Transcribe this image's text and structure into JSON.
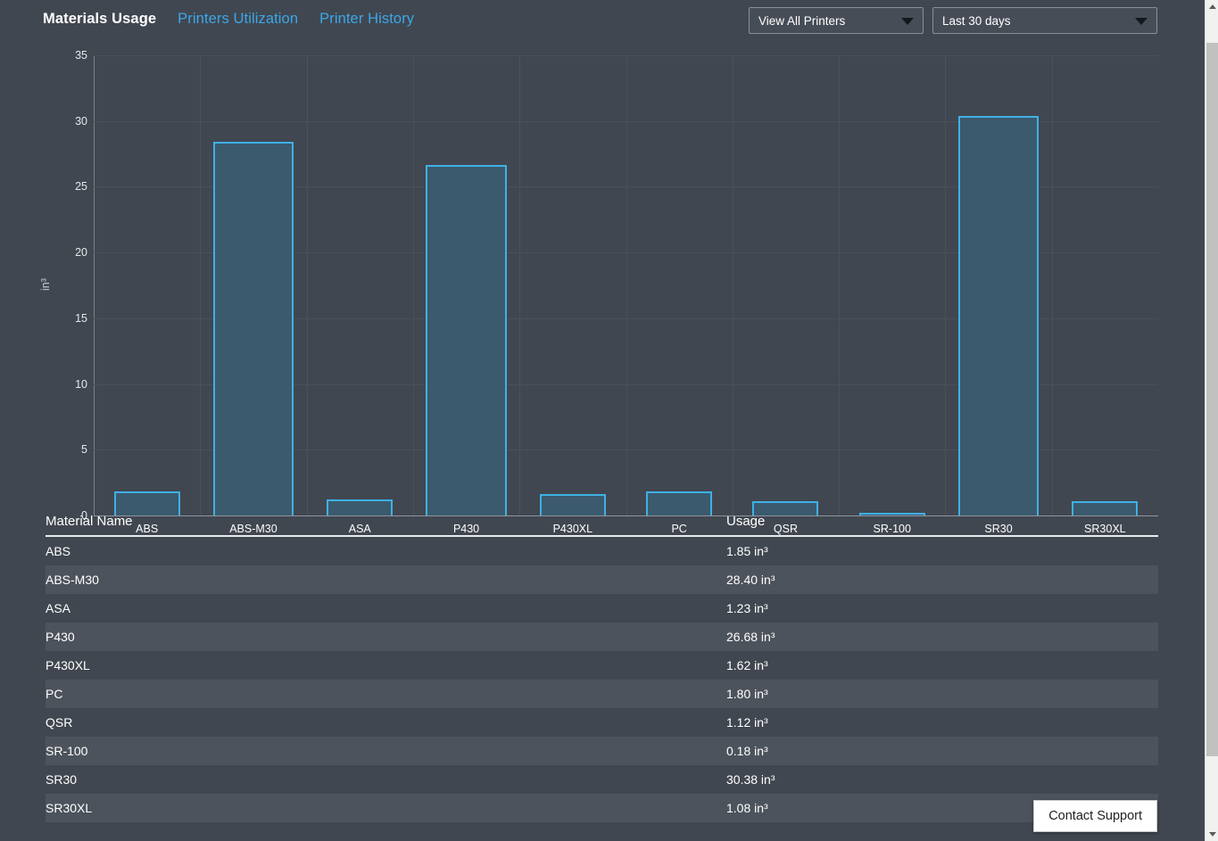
{
  "header": {
    "tabs": [
      {
        "label": "Materials Usage",
        "active": true
      },
      {
        "label": "Printers Utilization",
        "active": false
      },
      {
        "label": "Printer History",
        "active": false
      }
    ],
    "printer_select": {
      "value": "View All Printers",
      "icon": "chevron-down-icon"
    },
    "range_select": {
      "value": "Last 30 days",
      "icon": "chevron-down-icon"
    }
  },
  "chart_data": {
    "type": "bar",
    "title": "",
    "xlabel": "",
    "ylabel": "in³",
    "ylim": [
      0,
      35
    ],
    "yticks": [
      0,
      5,
      10,
      15,
      20,
      25,
      30,
      35
    ],
    "grid": true,
    "legend": "none",
    "bar_color": "#3b5a6d",
    "bar_border_color": "#3fb0e6",
    "categories": [
      "ABS",
      "ABS-M30",
      "ASA",
      "P430",
      "P430XL",
      "PC",
      "QSR",
      "SR-100",
      "SR30",
      "SR30XL"
    ],
    "values": [
      1.85,
      28.4,
      1.23,
      26.68,
      1.62,
      1.8,
      1.12,
      0.18,
      30.38,
      1.08
    ]
  },
  "table": {
    "columns": [
      "Material Name",
      "Usage"
    ],
    "rows": [
      {
        "name": "ABS",
        "usage": "1.85 in³"
      },
      {
        "name": "ABS-M30",
        "usage": "28.40 in³"
      },
      {
        "name": "ASA",
        "usage": "1.23 in³"
      },
      {
        "name": "P430",
        "usage": "26.68 in³"
      },
      {
        "name": "P430XL",
        "usage": "1.62 in³"
      },
      {
        "name": "PC",
        "usage": "1.80 in³"
      },
      {
        "name": "QSR",
        "usage": "1.12 in³"
      },
      {
        "name": "SR-100",
        "usage": "0.18 in³"
      },
      {
        "name": "SR30",
        "usage": "30.38 in³"
      },
      {
        "name": "SR30XL",
        "usage": "1.08 in³"
      }
    ]
  },
  "contact_support": {
    "label": "Contact Support"
  },
  "scrollbar": {
    "up_icon": "caret-up-icon",
    "down_icon": "caret-down-icon"
  },
  "colors": {
    "background": "#414750",
    "accent": "#3ba7e8",
    "bar_border": "#3fb0e6",
    "bar_fill": "#3b5a6d",
    "row_alt": "#4d535c"
  }
}
